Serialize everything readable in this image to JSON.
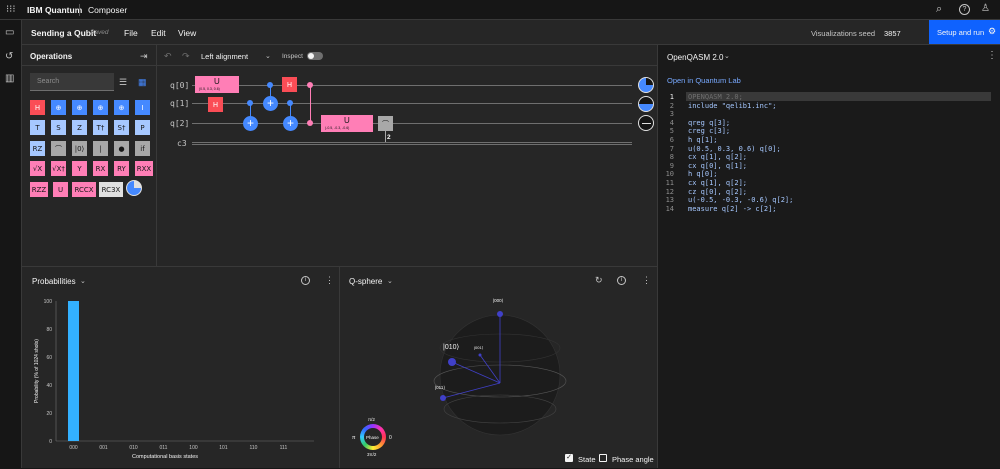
{
  "topbar": {
    "brand": "IBM Quantum",
    "section": "Composer"
  },
  "toolbar": {
    "file_name": "Sending a Qubit",
    "saved_status": "Saved",
    "menus": [
      "File",
      "Edit",
      "View"
    ],
    "seed_label": "Visualizations seed",
    "seed_value": "3857",
    "run_button": "Setup and run"
  },
  "operations": {
    "title": "Operations",
    "search_placeholder": "Search",
    "gates_row1": [
      "H",
      "⊕",
      "⊕",
      "⊕",
      "⊕",
      "I"
    ],
    "gates_row2": [
      "T",
      "S",
      "Z",
      "T†",
      "S†",
      "P"
    ],
    "gates_row3": [
      "RZ",
      "⌒",
      "|0⟩",
      "|",
      "●",
      "if"
    ],
    "gates_row4": [
      "√X",
      "√X†",
      "Y",
      "RX",
      "RY",
      "RXX"
    ],
    "gates_row5": [
      "RZZ",
      "U",
      "RCCX",
      "RC3X"
    ]
  },
  "canvas": {
    "alignment": "Left alignment",
    "inspect_label": "Inspect",
    "qubits": [
      "q[0]",
      "q[1]",
      "q[2]"
    ],
    "classical": "c3",
    "u_gate_label": "U",
    "u0_params": "(0.5, 0.3, 0.6)",
    "u2_params": "(-0.5, -0.3, -0.6)",
    "h_label": "H",
    "measure_index": "2"
  },
  "code": {
    "language": "OpenQASM 2.0",
    "open_lab": "Open in Quantum Lab",
    "lines": [
      "OPENQASM 2.0;",
      "include \"qelib1.inc\";",
      "",
      "qreg q[3];",
      "creg c[3];",
      "h q[1];",
      "u(0.5, 0.3, 0.6) q[0];",
      "cx q[1], q[2];",
      "cx q[0], q[1];",
      "h q[0];",
      "cx q[1], q[2];",
      "cz q[0], q[2];",
      "u(-0.5, -0.3, -0.6) q[2];",
      "measure q[2] -> c[2];"
    ],
    "line_numbers": [
      "1",
      "2",
      "3",
      "4",
      "5",
      "6",
      "7",
      "8",
      "9",
      "10",
      "11",
      "12",
      "13",
      "14"
    ]
  },
  "probabilities": {
    "title": "Probabilities",
    "ylabel": "Probability (% of 1024 shots)",
    "xlabel": "Computational basis states",
    "y_ticks": [
      "100",
      "80",
      "60",
      "40",
      "20",
      "0"
    ]
  },
  "qsphere": {
    "title": "Q-sphere",
    "states": [
      "|000⟩",
      "|010⟩",
      "|001⟩",
      "|011⟩"
    ],
    "phase_label": "Phase",
    "phase_top": "π/2",
    "phase_left": "π",
    "phase_right": "0",
    "phase_bottom": "3π/2",
    "state_checkbox": "State",
    "phase_angle_checkbox": "Phase angle"
  },
  "chart_data": {
    "type": "bar",
    "categories": [
      "000",
      "001",
      "010",
      "011",
      "100",
      "101",
      "110",
      "111"
    ],
    "values": [
      100,
      0,
      0,
      0,
      0,
      0,
      0,
      0
    ],
    "xlabel": "Computational basis states",
    "ylabel": "Probability (% of 1024 shots)",
    "ylim": [
      0,
      100
    ],
    "color": "#33b1ff"
  },
  "colors": {
    "accent": "#0f62fe",
    "bar": "#33b1ff"
  }
}
